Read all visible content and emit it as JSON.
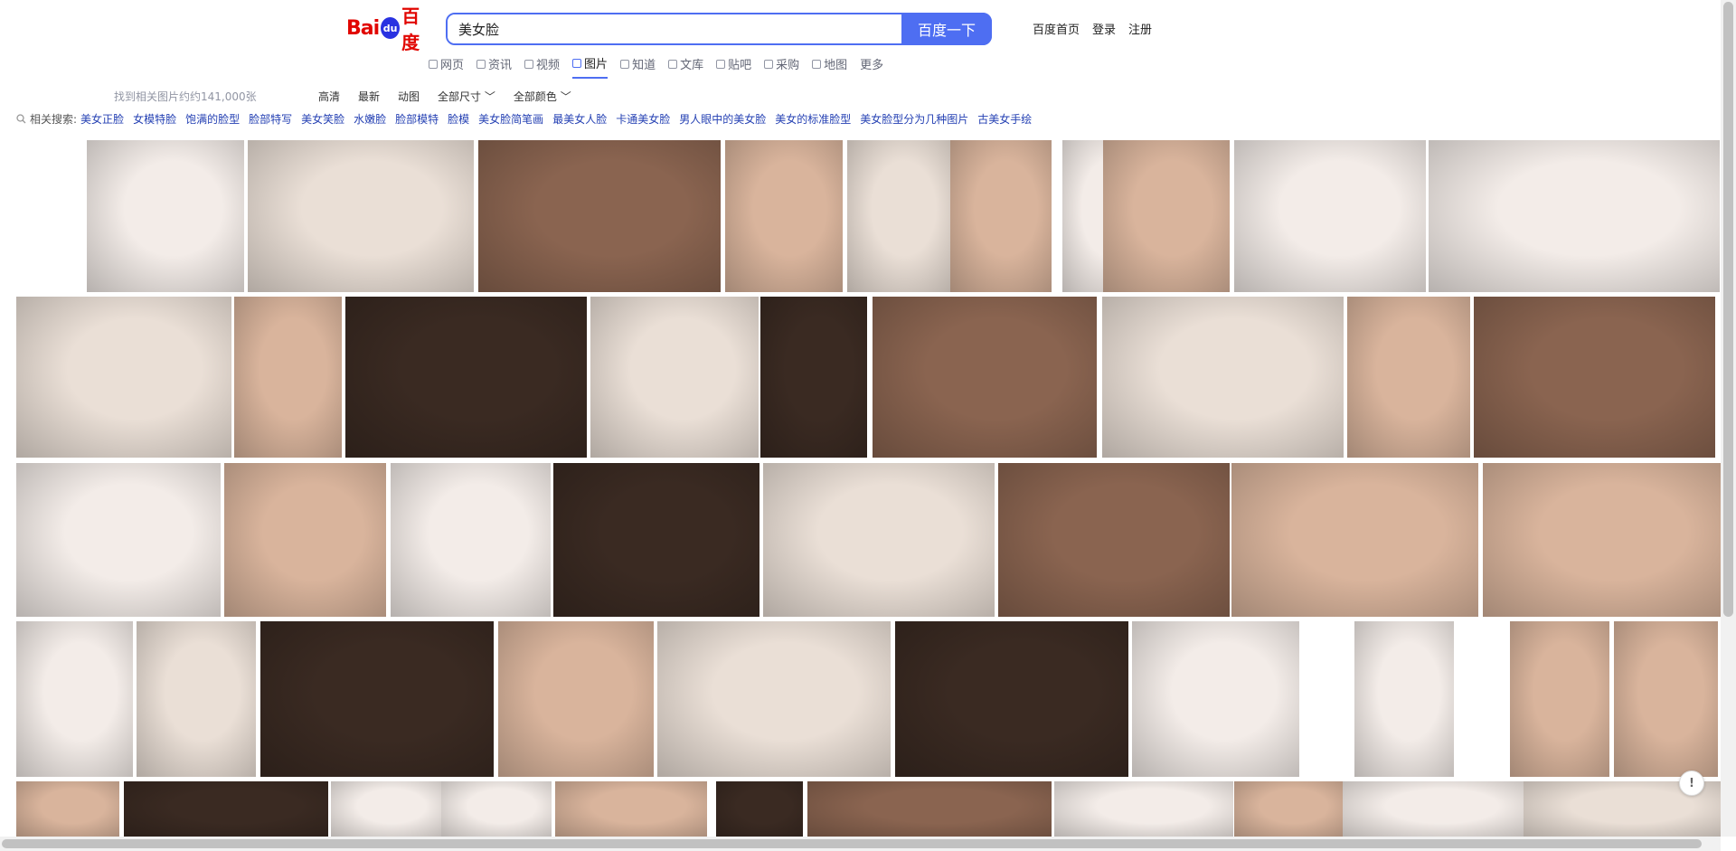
{
  "header": {
    "logo_text_latin": "Bai",
    "logo_paw_text": "du",
    "logo_text_cn": "百度",
    "search_value": "美女脸",
    "search_button": "百度一下",
    "links": [
      "百度首页",
      "登录",
      "注册"
    ]
  },
  "tabs": [
    {
      "label": "网页",
      "active": false
    },
    {
      "label": "资讯",
      "active": false
    },
    {
      "label": "视频",
      "active": false
    },
    {
      "label": "图片",
      "active": true
    },
    {
      "label": "知道",
      "active": false
    },
    {
      "label": "文库",
      "active": false
    },
    {
      "label": "贴吧",
      "active": false
    },
    {
      "label": "采购",
      "active": false
    },
    {
      "label": "地图",
      "active": false
    },
    {
      "label": "更多",
      "active": false
    }
  ],
  "result_count": "找到相关图片约约141,000张",
  "filters": [
    "高清",
    "最新",
    "动图",
    "全部尺寸 ﹀",
    "全部颜色 ﹀"
  ],
  "related": {
    "label": "相关搜索:",
    "items": [
      "美女正脸",
      "女模特脸",
      "饱满的脸型",
      "脸部特写",
      "美女笑脸",
      "水嫩脸",
      "脸部模特",
      "脸模",
      "美女脸简笔画",
      "最美女人脸",
      "卡通美女脸",
      "男人眼中的美女脸",
      "美女的标准脸型",
      "美女脸型分为几种图片",
      "古美女手绘"
    ]
  },
  "feedback_icon": "exclamation-icon",
  "image_tones": {
    "warm": "#d9b49c",
    "light": "#eadfd6",
    "dark": "#3a2a22",
    "pale": "#f3ece8",
    "brown": "#8a6450"
  }
}
